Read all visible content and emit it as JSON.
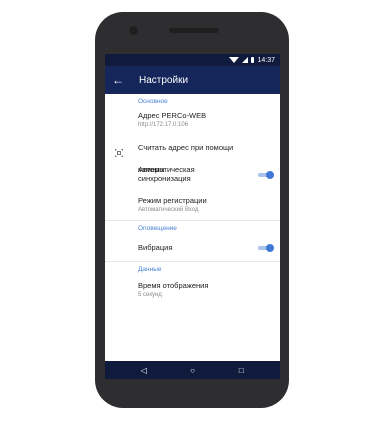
{
  "status_bar": {
    "time": "14:37"
  },
  "app_bar": {
    "back_icon": "←",
    "title": "Настройки"
  },
  "sections": [
    {
      "header": "Основное",
      "items": [
        {
          "title": "Адрес PERCo-WEB",
          "subtitle": "http://172.17.0.106"
        },
        {
          "title": "Считать адрес при помощи камеры",
          "icon": "qr-scan-icon"
        },
        {
          "title_line1": "Автоматическая",
          "title_line2": "синхронизация",
          "toggle_on": true
        },
        {
          "title": "Режим регистрации",
          "subtitle": "Автоматический Вход"
        }
      ]
    },
    {
      "header": "Оповещение",
      "items": [
        {
          "title": "Вибрация",
          "toggle_on": true
        }
      ]
    },
    {
      "header": "Данные",
      "items": [
        {
          "title": "Время отображения",
          "subtitle": "5 секунд"
        }
      ]
    }
  ],
  "nav_bar": {
    "back": "◁",
    "home": "○",
    "recents": "□"
  },
  "colors": {
    "app_bar": "#15265a",
    "status_bar": "#0f1a3c",
    "accent": "#3f79d8",
    "section_header": "#4a82d6"
  }
}
